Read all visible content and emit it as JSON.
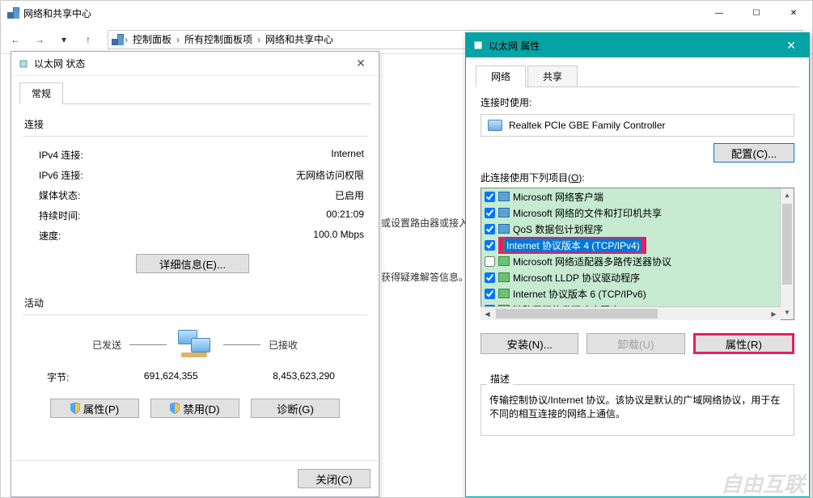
{
  "explorer": {
    "title": "网络和共享中心",
    "nav_up": "↑",
    "breadcrumb": [
      "控制面板",
      "所有控制面板项",
      "网络和共享中心"
    ],
    "hint1": "或设置路由器或接入",
    "hint2": "获得疑难解答信息。",
    "win_min": "—",
    "win_max": "☐",
    "win_close": "✕"
  },
  "status": {
    "title": "以太网 状态",
    "tab_general": "常规",
    "section_connection": "连接",
    "ipv4_label": "IPv4 连接:",
    "ipv4_value": "Internet",
    "ipv6_label": "IPv6 连接:",
    "ipv6_value": "无网络访问权限",
    "media_label": "媒体状态:",
    "media_value": "已启用",
    "duration_label": "持续时间:",
    "duration_value": "00:21:09",
    "speed_label": "速度:",
    "speed_value": "100.0 Mbps",
    "details_btn": "详细信息(E)...",
    "section_activity": "活动",
    "sent_label": "已发送",
    "recv_label": "已接收",
    "bytes_label": "字节:",
    "bytes_sent": "691,624,355",
    "bytes_recv": "8,453,623,290",
    "props_btn": "属性(P)",
    "disable_btn": "禁用(D)",
    "diag_btn": "诊断(G)",
    "close_btn": "关闭(C)"
  },
  "props": {
    "title": "以太网 属性",
    "tab_network": "网络",
    "tab_sharing": "共享",
    "connect_using": "连接时使用:",
    "adapter": "Realtek PCIe GBE Family Controller",
    "config_btn": "配置(C)...",
    "items_label_pre": "此连接使用下列项目(",
    "items_label_u": "O",
    "items_label_post": "):",
    "items": [
      {
        "checked": true,
        "label": "Microsoft 网络客户端"
      },
      {
        "checked": true,
        "label": "Microsoft 网络的文件和打印机共享"
      },
      {
        "checked": true,
        "label": "QoS 数据包计划程序"
      },
      {
        "checked": true,
        "label": "Internet 协议版本 4 (TCP/IPv4)",
        "highlighted": true
      },
      {
        "checked": false,
        "label": "Microsoft 网络适配器多路传送器协议"
      },
      {
        "checked": true,
        "label": "Microsoft LLDP 协议驱动程序"
      },
      {
        "checked": true,
        "label": "Internet 协议版本 6 (TCP/IPv6)"
      },
      {
        "checked": true,
        "label": "链路层拓扑发现响应程序"
      }
    ],
    "install_btn": "安装(N)...",
    "uninstall_btn": "卸载(U)",
    "properties_btn": "属性(R)",
    "desc_label": "描述",
    "desc_text": "传输控制协议/Internet 协议。该协议是默认的广域网络协议，用于在不同的相互连接的网络上通信。"
  },
  "watermark": "自由互联"
}
